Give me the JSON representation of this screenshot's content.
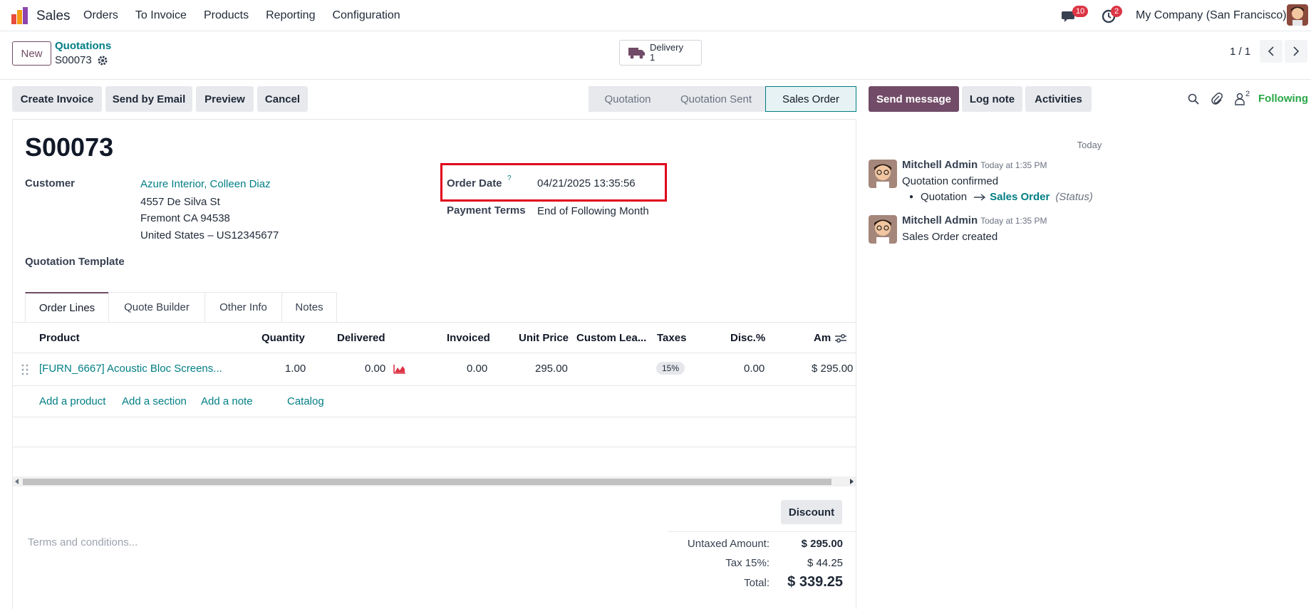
{
  "navbar": {
    "app_name": "Sales",
    "menu": [
      "Orders",
      "To Invoice",
      "Products",
      "Reporting",
      "Configuration"
    ],
    "messages_count": "10",
    "activities_count": "2",
    "company": "My Company (San Francisco)"
  },
  "control": {
    "new_label": "New",
    "breadcrumb_parent": "Quotations",
    "breadcrumb_current": "S00073",
    "delivery_label": "Delivery",
    "delivery_count": "1",
    "pager": "1 / 1"
  },
  "actions": {
    "create_invoice": "Create Invoice",
    "send_email": "Send by Email",
    "preview": "Preview",
    "cancel": "Cancel"
  },
  "status": {
    "steps": [
      "Quotation",
      "Quotation Sent",
      "Sales Order"
    ],
    "active": "Sales Order"
  },
  "chatter_actions": {
    "send_message": "Send message",
    "log_note": "Log note",
    "activities": "Activities",
    "followers_count": "2",
    "following": "Following"
  },
  "form": {
    "title": "S00073",
    "customer_label": "Customer",
    "customer_name": "Azure Interior, Colleen Diaz",
    "address_1": "4557 De Silva St",
    "address_2": "Fremont CA 94538",
    "address_3": "United States – US12345677",
    "template_label": "Quotation Template",
    "order_date_label": "Order Date",
    "order_date_help": "?",
    "order_date_value": "04/21/2025 13:35:56",
    "payment_terms_label": "Payment Terms",
    "payment_terms_value": "End of Following Month"
  },
  "tabs": [
    "Order Lines",
    "Quote Builder",
    "Other Info",
    "Notes"
  ],
  "table": {
    "headers": [
      "Product",
      "Quantity",
      "Delivered",
      "Invoiced",
      "Unit Price",
      "Custom Lea...",
      "Taxes",
      "Disc.%",
      "Am"
    ],
    "rows": [
      {
        "product": "[FURN_6667] Acoustic Bloc Screens...",
        "quantity": "1.00",
        "delivered": "0.00",
        "invoiced": "0.00",
        "unit_price": "295.00",
        "tax": "15%",
        "discount": "0.00",
        "amount": "$ 295.00"
      }
    ],
    "add_product": "Add a product",
    "add_section": "Add a section",
    "add_note": "Add a note",
    "catalog": "Catalog"
  },
  "footer": {
    "discount": "Discount",
    "terms_placeholder": "Terms and conditions...",
    "untaxed_label": "Untaxed Amount:",
    "untaxed_value": "$ 295.00",
    "tax_label": "Tax 15%:",
    "tax_value": "$ 44.25",
    "total_label": "Total:",
    "total_value": "$ 339.25"
  },
  "chatter": {
    "today": "Today",
    "messages": [
      {
        "author": "Mitchell Admin",
        "time": "Today at 1:35 PM",
        "text": "Quotation confirmed",
        "change_from": "Quotation",
        "change_to": "Sales Order",
        "change_field": "(Status)"
      },
      {
        "author": "Mitchell Admin",
        "time": "Today at 1:35 PM",
        "text": "Sales Order created"
      }
    ]
  },
  "colors": {
    "brand": "#714b67",
    "link": "#017e84",
    "highlight": "#e0001b",
    "following": "#28a745"
  }
}
